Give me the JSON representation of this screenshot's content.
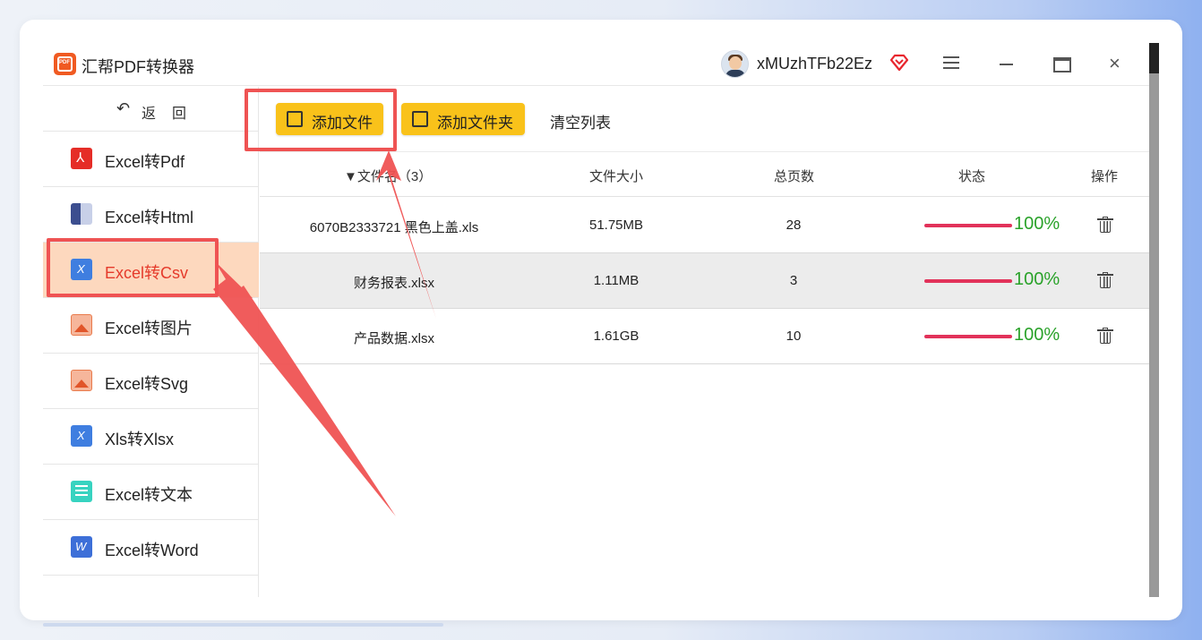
{
  "app": {
    "title": "汇帮PDF转换器",
    "logo_text": "PDF",
    "username": "xMUzhTFb22Ez"
  },
  "window_controls": {
    "menu": "menu-icon",
    "minimize": "minimize-icon",
    "maximize": "maximize-icon",
    "close": "×"
  },
  "sidebar": {
    "back": {
      "arrow": "↶",
      "label": "返回"
    },
    "items": [
      {
        "label": "Excel转Pdf",
        "icon": "pdf-icon",
        "active": false
      },
      {
        "label": "Excel转Html",
        "icon": "html-icon",
        "active": false
      },
      {
        "label": "Excel转Csv",
        "icon": "excel-x-icon",
        "active": true
      },
      {
        "label": "Excel转图片",
        "icon": "image-icon",
        "active": false
      },
      {
        "label": "Excel转Svg",
        "icon": "image-icon",
        "active": false
      },
      {
        "label": "Xls转Xlsx",
        "icon": "excel-x-icon",
        "active": false
      },
      {
        "label": "Excel转文本",
        "icon": "text-icon",
        "active": false
      },
      {
        "label": "Excel转Word",
        "icon": "word-icon",
        "active": false
      }
    ]
  },
  "toolbar": {
    "add_file": "添加文件",
    "add_folder": "添加文件夹",
    "clear_list": "清空列表"
  },
  "table": {
    "headers": {
      "filename": "▼文件名（3）",
      "size": "文件大小",
      "pages": "总页数",
      "status": "状态",
      "action": "操作"
    },
    "rows": [
      {
        "name": "6070B2333721 黑色上盖.xls",
        "size": "51.75MB",
        "pages": "28",
        "progress": 100,
        "status": "100%"
      },
      {
        "name": "财务报表.xlsx",
        "size": "1.11MB",
        "pages": "3",
        "progress": 100,
        "status": "100%"
      },
      {
        "name": "产品数据.xlsx",
        "size": "1.61GB",
        "pages": "10",
        "progress": 100,
        "status": "100%"
      }
    ]
  },
  "colors": {
    "accent_button": "#f9c21a",
    "active_sidebar_bg": "#fdd8be",
    "active_sidebar_text": "#e53a2b",
    "progress_bar": "#e2325a",
    "progress_text": "#2aa22a",
    "annotation": "#ef5353"
  }
}
